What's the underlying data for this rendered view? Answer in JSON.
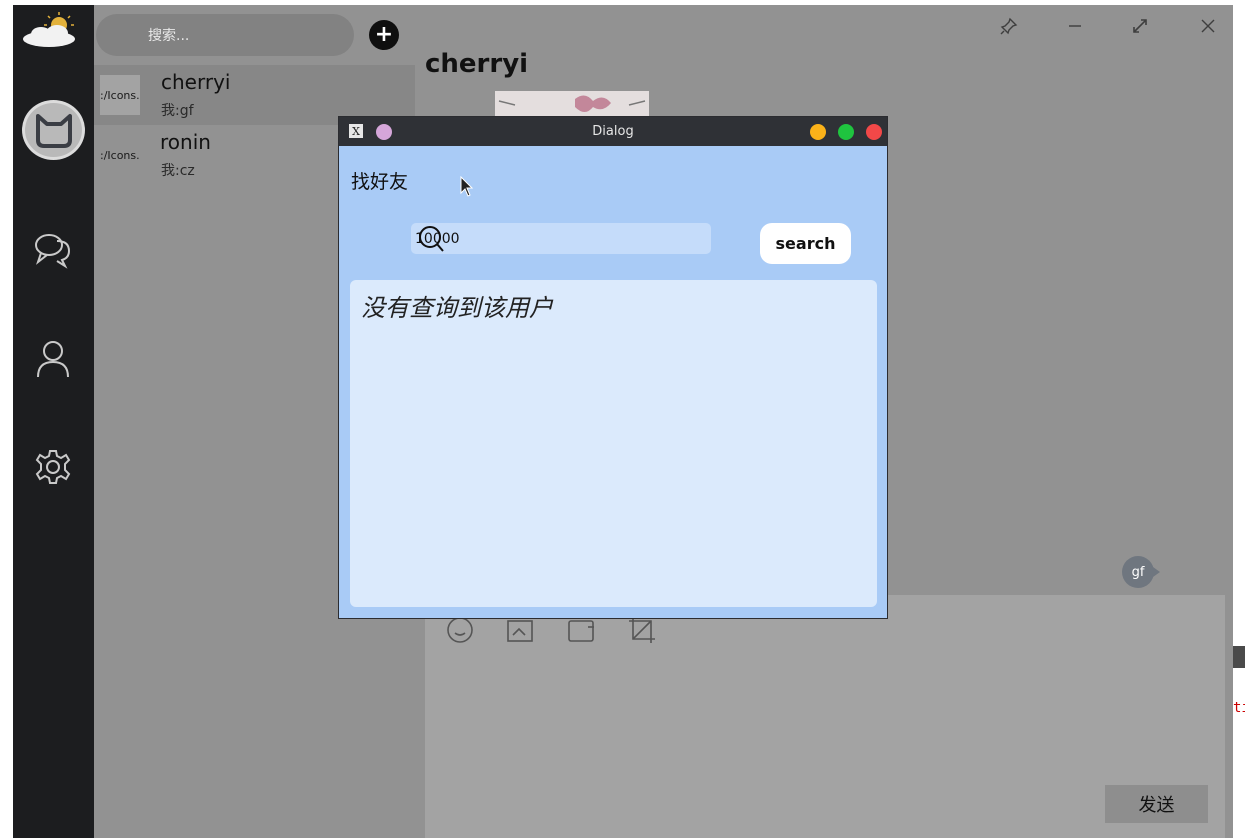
{
  "app": {
    "contacts_search_placeholder": "搜索...",
    "add_label": "+",
    "contacts": [
      {
        "thumb_text": ":/Icons.",
        "name": "cherryi",
        "last_message": "我:gf",
        "active": true
      },
      {
        "thumb_text": ":/Icons.",
        "name": "ronin",
        "last_message": "我:cz",
        "active": false
      }
    ],
    "nav_icons": [
      "chat-icon",
      "contacts-icon",
      "settings-icon"
    ]
  },
  "chat": {
    "title": "cherryi",
    "bubble_text": "gf",
    "send_label": "发送",
    "window_controls": [
      "pin-icon",
      "minimize-icon",
      "maximize-icon",
      "close-icon"
    ],
    "toolbar_icons": [
      "emoji-icon",
      "file-icon",
      "folder-icon",
      "screenshot-icon"
    ]
  },
  "dialog": {
    "title": "Dialog",
    "heading": "找好友",
    "search_value": "10000",
    "search_button": "search",
    "result_text": "没有查询到该用户",
    "dot_colors": {
      "lilac": "#d5a6d9",
      "yellow": "#fbb219",
      "green": "#1fc43f",
      "red": "#f24848"
    }
  },
  "backdrop": {
    "right_fragment": "ti"
  }
}
